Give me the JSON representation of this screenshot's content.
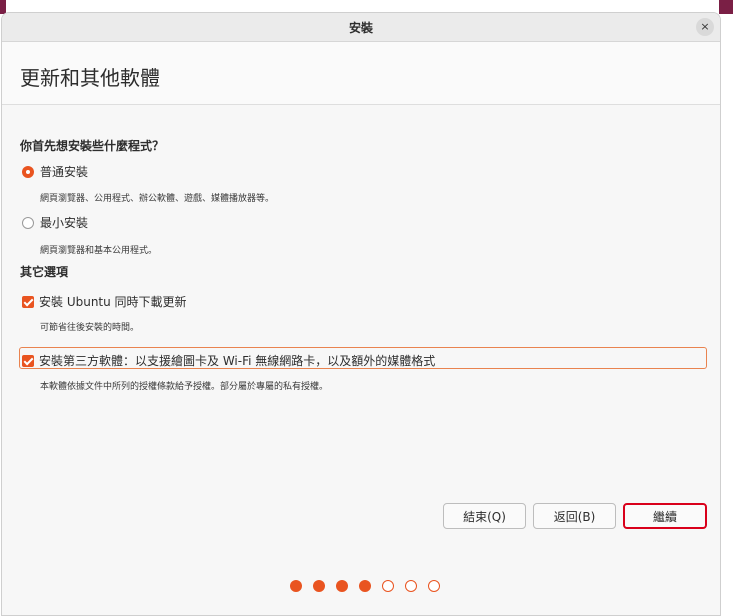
{
  "window": {
    "title": "安裝",
    "close_glyph": "×"
  },
  "header": {
    "title": "更新和其他軟體"
  },
  "install_type": {
    "question": "你首先想安裝些什麼程式？",
    "options": [
      {
        "label": "普通安裝",
        "description": "網頁瀏覽器、公用程式、辦公軟體、遊戲、媒體播放器等。",
        "selected": true
      },
      {
        "label": "最小安裝",
        "description": "網頁瀏覽器和基本公用程式。",
        "selected": false
      }
    ]
  },
  "other_options": {
    "heading": "其它選項",
    "items": [
      {
        "label": "安裝 Ubuntu 同時下載更新",
        "description": "可節省往後安裝的時間。",
        "checked": true
      },
      {
        "label": "安裝第三方軟體：以支援繪圖卡及 Wi-Fi 無線網路卡，以及額外的媒體格式",
        "description": "本軟體依據文件中所列的授權條款給予授權。部分屬於專屬的私有授權。",
        "checked": true
      }
    ]
  },
  "buttons": {
    "quit": "結束(Q)",
    "back": "返回(B)",
    "continue": "繼續"
  },
  "progress": {
    "total_steps": 7,
    "completed_steps": 4
  },
  "colors": {
    "accent": "#e95420",
    "highlight": "#d9001b"
  }
}
